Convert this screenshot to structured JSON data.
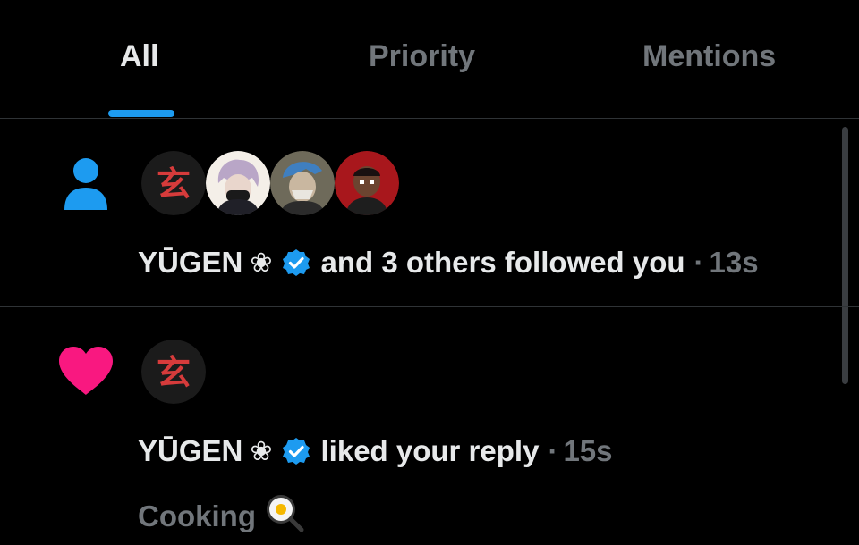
{
  "tabs": [
    {
      "label": "All",
      "active": true
    },
    {
      "label": "Priority",
      "active": false
    },
    {
      "label": "Mentions",
      "active": false
    }
  ],
  "colors": {
    "accent": "#1d9bf0",
    "like": "#f91880",
    "muted": "#71767b",
    "text": "#e7e9ea"
  },
  "notifications": [
    {
      "type_icon": "person-icon",
      "avatars": [
        "yugen-avatar",
        "purple-hair-avatar",
        "blue-hair-avatar",
        "red-bg-avatar"
      ],
      "name": "YŪGEN",
      "name_symbol": "❀",
      "verified": true,
      "action": "and 3 others followed you",
      "separator": "·",
      "time": "13s"
    },
    {
      "type_icon": "heart-icon",
      "avatars": [
        "yugen-avatar"
      ],
      "name": "YŪGEN",
      "name_symbol": "❀",
      "verified": true,
      "action": "liked your reply",
      "separator": "·",
      "time": "15s",
      "snippet": "Cooking",
      "snippet_emoji": "frying-pan-egg-icon"
    }
  ]
}
